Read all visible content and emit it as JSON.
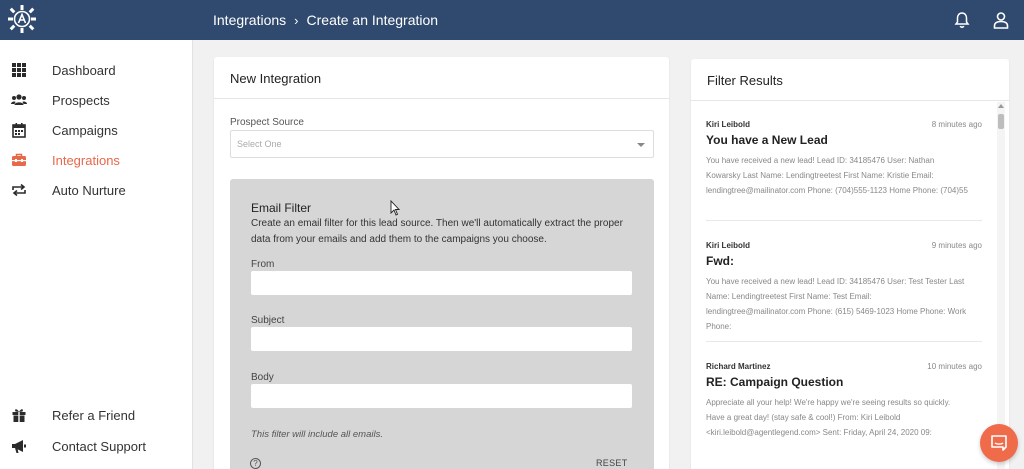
{
  "header": {
    "breadcrumb_root": "Integrations",
    "breadcrumb_sep": "›",
    "breadcrumb_current": "Create an Integration"
  },
  "sidebar": {
    "items": [
      {
        "label": "Dashboard",
        "icon": "grid-icon"
      },
      {
        "label": "Prospects",
        "icon": "people-icon"
      },
      {
        "label": "Campaigns",
        "icon": "calendar-icon"
      },
      {
        "label": "Integrations",
        "icon": "toolbox-icon",
        "active": true
      },
      {
        "label": "Auto Nurture",
        "icon": "repeat-icon"
      }
    ],
    "bottom": [
      {
        "label": "Refer a Friend",
        "icon": "gift-icon"
      },
      {
        "label": "Contact Support",
        "icon": "megaphone-icon"
      }
    ]
  },
  "integration": {
    "title": "New Integration",
    "prospect_source_label": "Prospect Source",
    "prospect_source_placeholder": "Select One",
    "email_filter": {
      "title": "Email Filter",
      "description": "Create an email filter for this lead source. Then we'll automatically extract the proper data from your emails and add them to the campaigns you choose.",
      "from_label": "From",
      "subject_label": "Subject",
      "body_label": "Body",
      "note": "This filter will include all emails.",
      "help": "?",
      "reset_label": "RESET"
    }
  },
  "filter_results": {
    "title": "Filter Results",
    "messages": [
      {
        "sender": "Kiri Leibold",
        "time": "8 minutes ago",
        "subject": "You have a New Lead",
        "body": "You have received a new lead! Lead ID: 34185476 User: Nathan Kowarsky Last Name: Lendingtreetest First Name: Kristie Email: lendingtree@mailinator.com Phone: (704)555-1123 Home Phone: (704)55"
      },
      {
        "sender": "Kiri Leibold",
        "time": "9 minutes ago",
        "subject": "Fwd:",
        "body": "You have received a new lead! Lead ID: 34185476 User: Test Tester Last Name: Lendingtreetest First Name: Test Email: lendingtree@mailinator.com Phone: (615) 5469-1023 Home Phone: Work Phone:"
      },
      {
        "sender": "Richard Martinez",
        "time": "10 minutes ago",
        "subject": "RE: Campaign Question",
        "body": "Appreciate all your help! We're happy we're seeing results so quickly. Have a great day! (stay safe & cool!) From: Kiri Leibold <kiri.leibold@agentlegend.com> Sent: Friday, April 24, 2020 09:"
      }
    ]
  },
  "colors": {
    "topbar": "#2f4a6e",
    "accent": "#e8684a",
    "chat": "#ef6b4a"
  }
}
